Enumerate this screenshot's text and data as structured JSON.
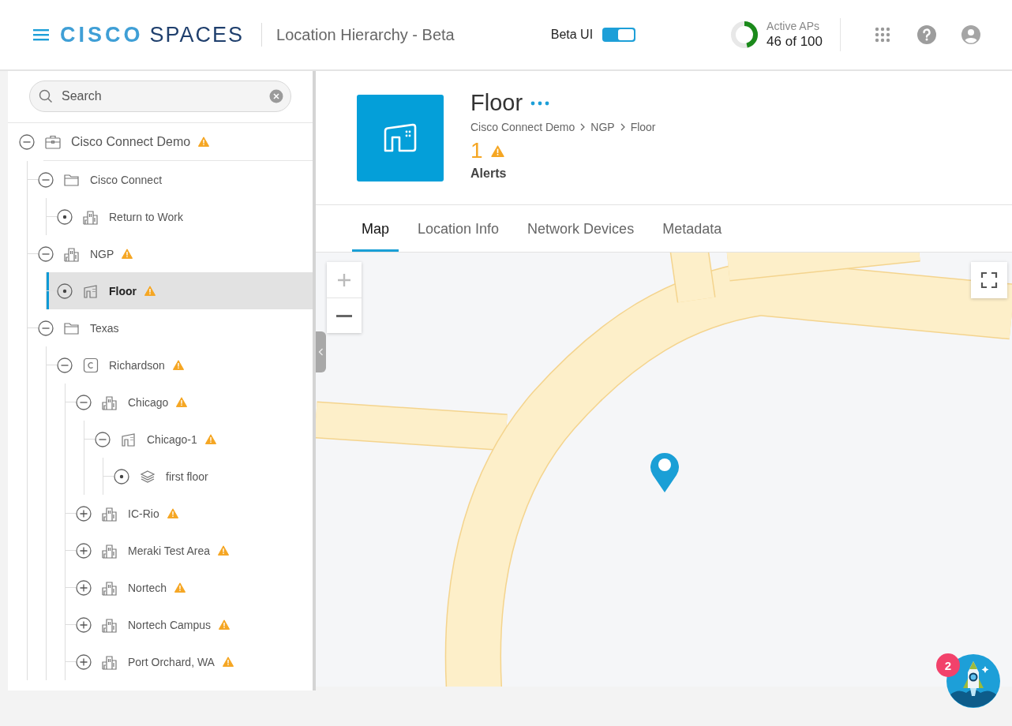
{
  "header": {
    "logo": {
      "first": "CISCO",
      "second": "SPACES"
    },
    "app_title": "Location Hierarchy - Beta",
    "beta_toggle": {
      "label": "Beta UI",
      "on": true
    },
    "active_aps": {
      "label": "Active APs",
      "value": "46 of 100"
    }
  },
  "sidebar": {
    "search": {
      "placeholder": "Search"
    },
    "tree": [
      {
        "label": "Cisco Connect Demo",
        "kind": "company",
        "alert": true,
        "selected": false,
        "expanded": true,
        "children": [
          {
            "label": "Cisco Connect",
            "kind": "folder",
            "alert": false,
            "selected": false,
            "expanded": true,
            "children": [
              {
                "label": "Return to Work",
                "kind": "building",
                "alert": false,
                "selected": false
              }
            ]
          },
          {
            "label": "NGP",
            "kind": "building",
            "alert": true,
            "selected": false,
            "expanded": true,
            "children": [
              {
                "label": "Floor",
                "kind": "floor",
                "alert": true,
                "selected": true
              }
            ]
          },
          {
            "label": "Texas",
            "kind": "folder",
            "alert": false,
            "selected": false,
            "expanded": true,
            "children": [
              {
                "label": "Richardson",
                "kind": "campus",
                "alert": true,
                "selected": false,
                "expanded": true,
                "children": [
                  {
                    "label": "Chicago",
                    "kind": "building",
                    "alert": true,
                    "selected": false,
                    "expanded": true,
                    "children": [
                      {
                        "label": "Chicago-1",
                        "kind": "floor",
                        "alert": true,
                        "selected": false,
                        "expanded": true,
                        "children": [
                          {
                            "label": "first floor",
                            "kind": "level",
                            "alert": false,
                            "selected": false
                          }
                        ]
                      }
                    ]
                  },
                  {
                    "label": "IC-Rio",
                    "kind": "building",
                    "alert": true,
                    "selected": false,
                    "expanded": false
                  },
                  {
                    "label": "Meraki Test Area",
                    "kind": "building",
                    "alert": true,
                    "selected": false,
                    "expanded": false
                  },
                  {
                    "label": "Nortech",
                    "kind": "building",
                    "alert": true,
                    "selected": false,
                    "expanded": false
                  },
                  {
                    "label": "Nortech Campus",
                    "kind": "building",
                    "alert": true,
                    "selected": false,
                    "expanded": false
                  },
                  {
                    "label": "Port Orchard, WA",
                    "kind": "building",
                    "alert": true,
                    "selected": false,
                    "expanded": false
                  }
                ]
              }
            ]
          }
        ]
      }
    ]
  },
  "detail": {
    "title": "Floor",
    "breadcrumb": [
      "Cisco Connect Demo",
      "NGP",
      "Floor"
    ],
    "alert_count": "1",
    "alert_label": "Alerts"
  },
  "tabs": [
    {
      "label": "Map",
      "selected": true
    },
    {
      "label": "Location Info",
      "selected": false
    },
    {
      "label": "Network Devices",
      "selected": false
    },
    {
      "label": "Metadata",
      "selected": false
    }
  ],
  "assistant": {
    "badge": "2"
  }
}
